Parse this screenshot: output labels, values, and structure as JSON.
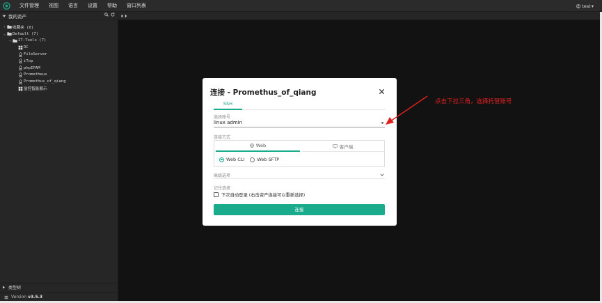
{
  "menu": [
    "文件管理",
    "视图",
    "语言",
    "设置",
    "帮助",
    "窗口列表"
  ],
  "user": {
    "name": "test",
    "caret": "▾"
  },
  "sidebar": {
    "header": "我的资产",
    "tree": [
      {
        "label": "收藏夹 (0)",
        "type": "folder",
        "expand": "›",
        "level": 0
      },
      {
        "label": "Default (7)",
        "type": "folder",
        "expand": "⌄",
        "level": 0
      },
      {
        "label": "IT-Tools (7)",
        "type": "folder",
        "expand": "⌄",
        "level": 1
      },
      {
        "label": "DC",
        "type": "windows",
        "level": 2
      },
      {
        "label": "FileServer",
        "type": "linux",
        "level": 2
      },
      {
        "label": "iTop",
        "type": "linux",
        "level": 2
      },
      {
        "label": "phpIPAM",
        "type": "linux",
        "level": 2
      },
      {
        "label": "Prometheus",
        "type": "linux",
        "level": 2
      },
      {
        "label": "Promethus_of_qiang",
        "type": "linux",
        "level": 2
      },
      {
        "label": "监控智能展示",
        "type": "windows",
        "level": 2
      }
    ],
    "type_tree": "类型树",
    "version_label": "Version",
    "version": "v3.5.3"
  },
  "modal": {
    "title": "连接 - Promethus_of_qiang",
    "tab": "SSH",
    "account_label": "选择账号",
    "account_value": "linux admin",
    "method_label": "连接方式",
    "method_tabs": [
      "Web",
      "客户端"
    ],
    "options": [
      "Web CLI",
      "Web SFTP"
    ],
    "advanced_label": "高级选项",
    "remember_label": "记住选择",
    "auto_login": "下次自动登录 (右击资产连接可以重新选择)",
    "connect": "连接"
  },
  "annotation": "点击下拉三角，选择托管账号",
  "colors": {
    "accent": "#1aaa8c",
    "annotation": "#e02020"
  }
}
